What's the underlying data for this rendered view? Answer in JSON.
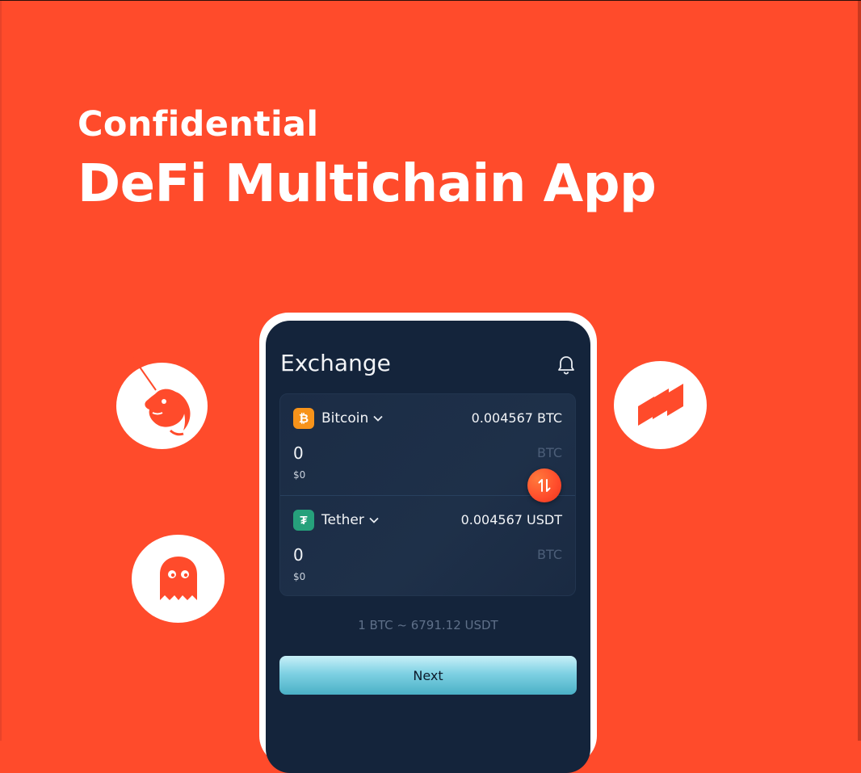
{
  "hero": {
    "subtitle": "Confidential",
    "title": "DeFi Multichain App"
  },
  "logos": [
    {
      "name": "uniswap-unicorn-icon"
    },
    {
      "name": "ghost-icon"
    },
    {
      "name": "compound-icon"
    }
  ],
  "screen": {
    "title": "Exchange",
    "notification_icon": "bell-icon"
  },
  "from": {
    "coin": "Bitcoin",
    "coin_symbol_glyph": "₿",
    "coin_color": "#f7931a",
    "balance": "0.004567 BTC",
    "amount": "0",
    "fiat": "$0",
    "unit": "BTC"
  },
  "to": {
    "coin": "Tether",
    "coin_symbol_glyph": "₮",
    "coin_color": "#26a17b",
    "balance": "0.004567 USDT",
    "amount": "0",
    "fiat": "$0",
    "unit": "BTC"
  },
  "rate": "1 BTC ~ 6791.12 USDT",
  "next_label": "Next",
  "colors": {
    "background": "#ff4b2b",
    "screen": "#14243b",
    "accent": "#4ab0c6"
  }
}
